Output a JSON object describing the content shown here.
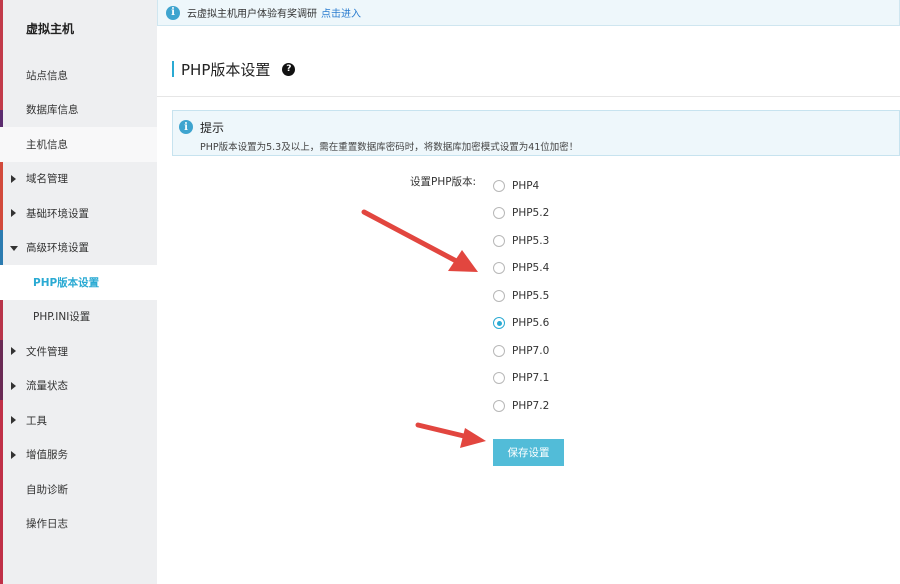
{
  "notice": {
    "icon": "info-icon",
    "text": "云虚拟主机用户体验有奖调研",
    "link": "点击进入"
  },
  "sidebar": {
    "title": "虚拟主机",
    "items": [
      {
        "label": "站点信息",
        "caret": "none"
      },
      {
        "label": "数据库信息",
        "caret": "none"
      },
      {
        "label": "主机信息",
        "caret": "none"
      },
      {
        "label": "域名管理",
        "caret": "right"
      },
      {
        "label": "基础环境设置",
        "caret": "right"
      },
      {
        "label": "高级环境设置",
        "caret": "down"
      },
      {
        "label": "PHP版本设置",
        "caret": "none"
      },
      {
        "label": "PHP.INI设置",
        "caret": "none"
      },
      {
        "label": "文件管理",
        "caret": "right"
      },
      {
        "label": "流量状态",
        "caret": "right"
      },
      {
        "label": "工具",
        "caret": "right"
      },
      {
        "label": "增值服务",
        "caret": "right"
      },
      {
        "label": "自助诊断",
        "caret": "none"
      },
      {
        "label": "操作日志",
        "caret": "none"
      }
    ],
    "selected": "PHP版本设置"
  },
  "page": {
    "title": "PHP版本设置",
    "help_icon": "question-circle-icon"
  },
  "tip": {
    "title": "提示",
    "body": "PHP版本设置为5.3及以上，需在重置数据库密码时，将数据库加密模式设置为41位加密！"
  },
  "form": {
    "label": "设置PHP版本:",
    "options": [
      "PHP4",
      "PHP5.2",
      "PHP5.3",
      "PHP5.4",
      "PHP5.5",
      "PHP5.6",
      "PHP7.0",
      "PHP7.1",
      "PHP7.2"
    ],
    "selected": "PHP5.6",
    "save_label": "保存设置"
  },
  "colors": {
    "accent": "#2aaad3",
    "button": "#52bcd8",
    "arrow": "#e2463f",
    "sidebar_bg": "#eeeff1"
  }
}
